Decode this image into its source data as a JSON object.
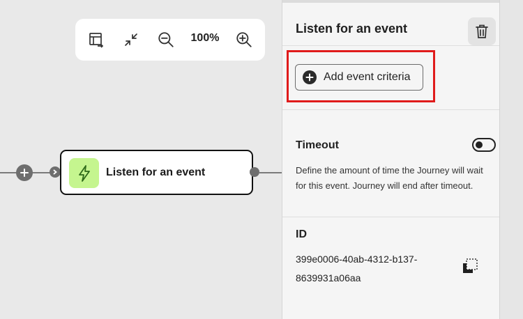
{
  "toolbar": {
    "zoom_level": "100%",
    "icons": [
      "switch-layout-icon",
      "collapse-icon",
      "zoom-out-icon",
      "zoom-in-icon"
    ]
  },
  "canvas": {
    "node": {
      "label": "Listen for an event",
      "icon": "lightning-bolt-icon",
      "icon_bg": "#c5f58f"
    }
  },
  "panel": {
    "title": "Listen for an event",
    "add_criteria_label": "Add event criteria",
    "highlight_color": "#e01b1b",
    "timeout": {
      "label": "Timeout",
      "enabled": false,
      "description": "Define the amount of time the Journey will wait for this event. Journey will end after timeout."
    },
    "id": {
      "label": "ID",
      "value": "399e0006-40ab-4312-b137-8639931a06aa"
    }
  }
}
